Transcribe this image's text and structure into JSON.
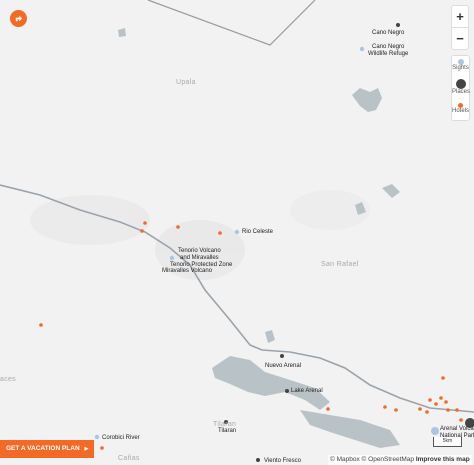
{
  "map": {
    "region_labels": [
      {
        "id": "upala",
        "text": "Upala"
      },
      {
        "id": "san-rafael",
        "text": "San Rafael"
      },
      {
        "id": "tilaran-faint",
        "text": "Tilaran"
      },
      {
        "id": "canas",
        "text": "Cañas"
      },
      {
        "id": "left-edge",
        "text": "aces"
      }
    ],
    "place_labels": [
      {
        "id": "cano-negro",
        "text": "Cano Negro"
      },
      {
        "id": "cano-negro-refuge",
        "text": "Cano Negro\nWildlife Refuge"
      },
      {
        "id": "rio-celeste",
        "text": "Rio Celeste"
      },
      {
        "id": "tenorio-volcano",
        "text": "Tenorio Volcano\nand Miravalles"
      },
      {
        "id": "tenorio-protected",
        "text": "Tenorio Protected Zone"
      },
      {
        "id": "miravalles-volcano",
        "text": "Miravalles Volcano"
      },
      {
        "id": "nuevo-arenal",
        "text": "Nuevo Arenal"
      },
      {
        "id": "lake-arenal",
        "text": "Lake Arenal"
      },
      {
        "id": "arenal-volcano-np",
        "text": "Arenal Volcano\nNational Park"
      },
      {
        "id": "tilaran",
        "text": "Tilaran"
      },
      {
        "id": "corobici-river",
        "text": "Corobici River"
      },
      {
        "id": "viento-fresco",
        "text": "Viento Fresco"
      }
    ]
  },
  "controls": {
    "zoom_in": "+",
    "zoom_out": "−",
    "legend": [
      {
        "label": "Sights",
        "color": "#a9c6e6"
      },
      {
        "label": "Places",
        "color": "#444444"
      },
      {
        "label": "Hotels",
        "color": "#f26a25"
      }
    ],
    "cta_label": "GET A VACATION PLAN",
    "cta_arrow": "▶",
    "share_icon": "share-arrow-icon"
  },
  "attribution": {
    "mapbox": "© Mapbox",
    "osm": "© OpenStreetMap",
    "improve": "Improve this map"
  },
  "scale": {
    "label": "5km"
  },
  "colors": {
    "accent": "#f26a25",
    "sight": "#a9c6e6",
    "place": "#444444",
    "water": "#b9c2c6",
    "road": "#9aa3ab",
    "border": "#9a9a9a"
  }
}
